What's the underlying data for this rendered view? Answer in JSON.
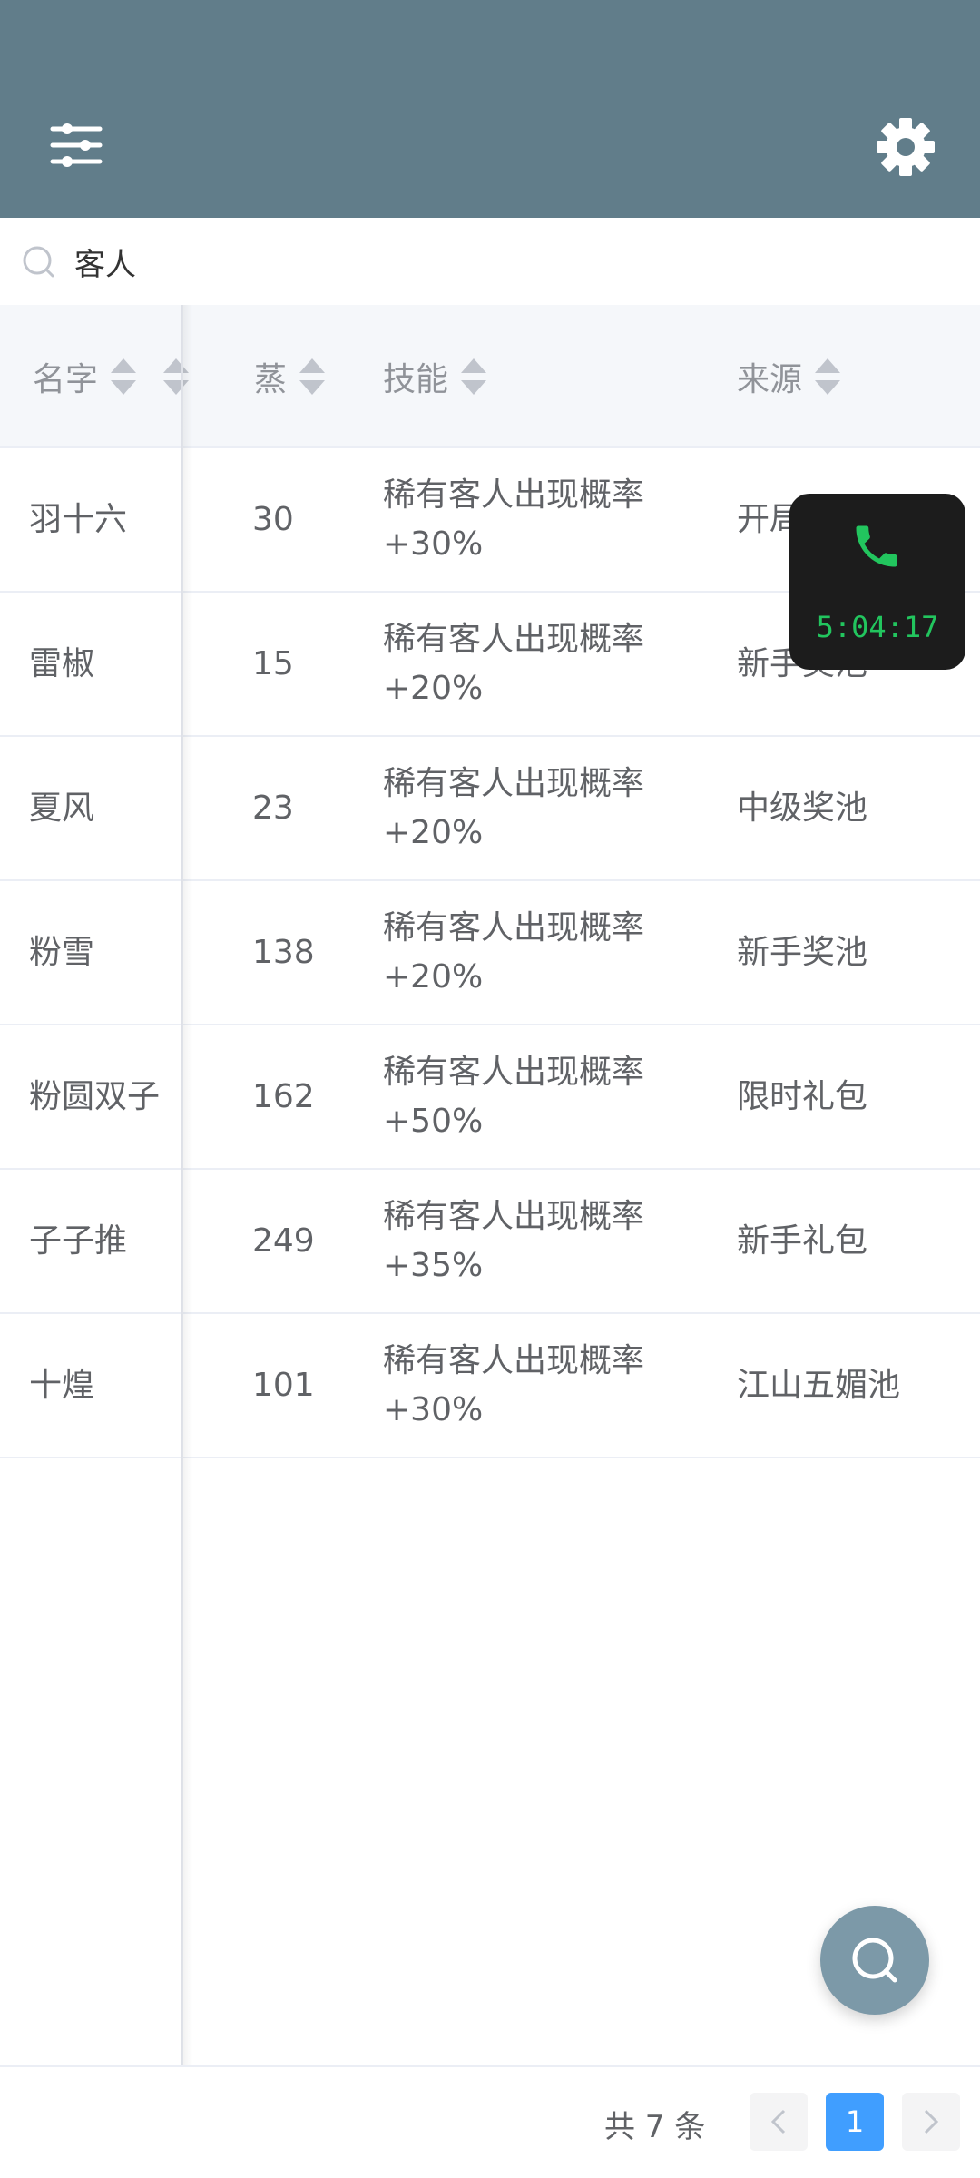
{
  "search": {
    "value": "客人",
    "placeholder": ""
  },
  "table": {
    "headers": {
      "name": "名字",
      "steam": "蒸",
      "skill": "技能",
      "source": "来源"
    },
    "rows": [
      {
        "name": "羽十六",
        "steam": "30",
        "skill": "稀有客人出现概率+30%",
        "source": "开局"
      },
      {
        "name": "雷椒",
        "steam": "15",
        "skill": "稀有客人出现概率+20%",
        "source": "新手奖池"
      },
      {
        "name": "夏风",
        "steam": "23",
        "skill": "稀有客人出现概率+20%",
        "source": "中级奖池"
      },
      {
        "name": "粉雪",
        "steam": "138",
        "skill": "稀有客人出现概率+20%",
        "source": "新手奖池"
      },
      {
        "name": "粉圆双子",
        "steam": "162",
        "skill": "稀有客人出现概率+50%",
        "source": "限时礼包"
      },
      {
        "name": "子子推",
        "steam": "249",
        "skill": "稀有客人出现概率+35%",
        "source": "新手礼包"
      },
      {
        "name": "十煌",
        "steam": "101",
        "skill": "稀有客人出现概率+30%",
        "source": "江山五媚池"
      }
    ]
  },
  "call": {
    "timer": "5:04:17"
  },
  "pagination": {
    "total_text": "共 7 条",
    "current_page": "1"
  },
  "colors": {
    "header": "#617d8a",
    "accent": "#409eff",
    "call_green": "#22c55e"
  }
}
